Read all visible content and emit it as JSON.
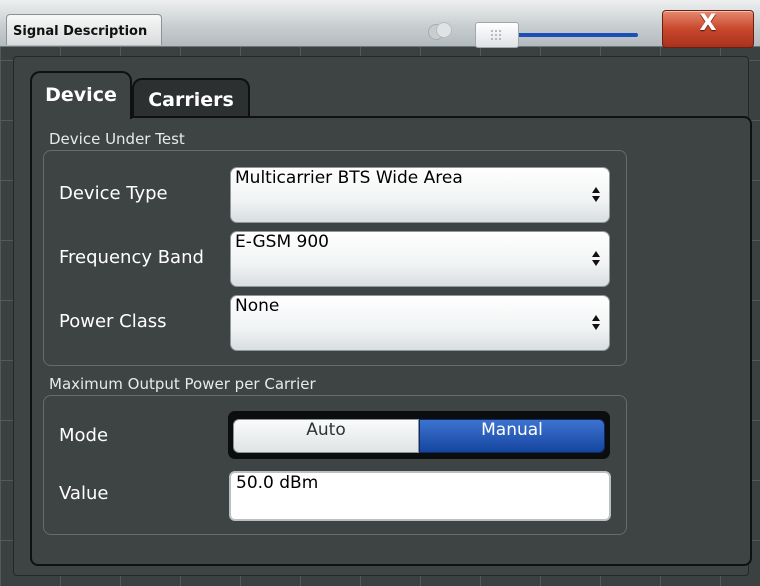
{
  "window": {
    "title": "Signal Description",
    "close_label": "X"
  },
  "tabs": [
    {
      "label": "Device",
      "active": true
    },
    {
      "label": "Carriers",
      "active": false
    }
  ],
  "device_under_test": {
    "group_title": "Device Under Test",
    "fields": [
      {
        "label": "Device Type",
        "value": "Multicarrier BTS Wide Area"
      },
      {
        "label": "Frequency Band",
        "value": "E-GSM 900"
      },
      {
        "label": "Power Class",
        "value": "None"
      }
    ]
  },
  "max_output_power": {
    "group_title": "Maximum Output Power per Carrier",
    "mode": {
      "label": "Mode",
      "options": [
        "Auto",
        "Manual"
      ],
      "selected": "Manual"
    },
    "value": {
      "label": "Value",
      "text": "50.0 dBm"
    }
  },
  "colors": {
    "accent": "#1d4fb8",
    "close_button": "#c8472c",
    "selected_toggle": "#15469f"
  },
  "icons": [
    "status-dots-icon",
    "slider-grip-icon",
    "close-icon",
    "dropdown-arrow-icon"
  ]
}
